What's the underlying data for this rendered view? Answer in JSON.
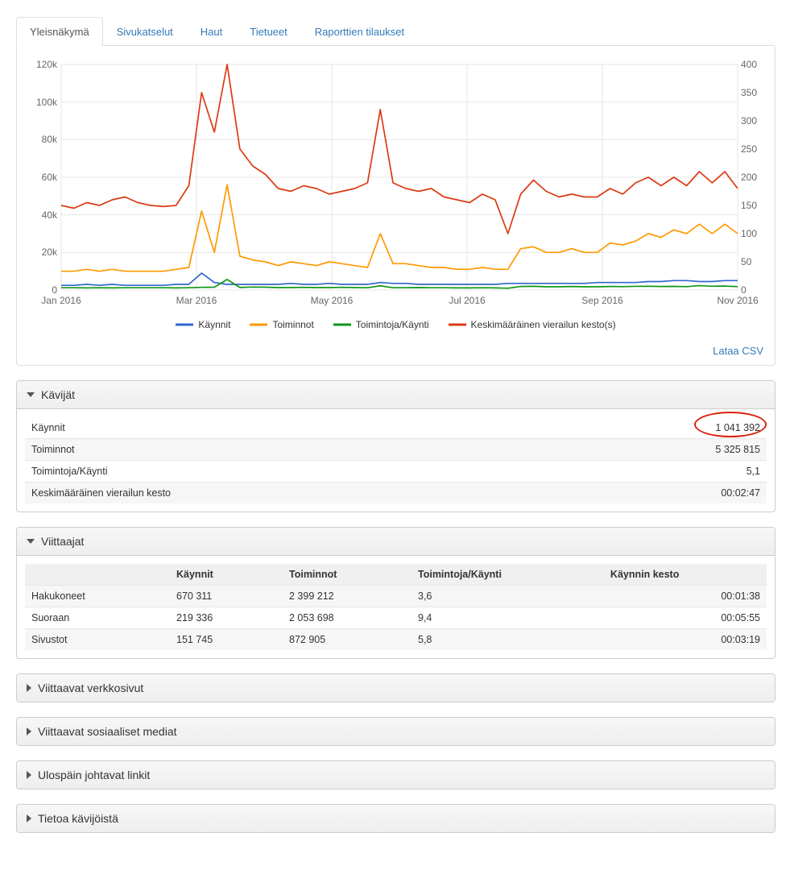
{
  "tabs": [
    "Yleisnäkymä",
    "Sivukatselut",
    "Haut",
    "Tietueet",
    "Raporttien tilaukset"
  ],
  "legend": {
    "visits": "Käynnit",
    "actions": "Toiminnot",
    "perVisit": "Toimintoja/Käynti",
    "avgDuration": "Keskimääräinen vierailun kesto(s)"
  },
  "download": "Lataa CSV",
  "panel_visitors": {
    "title": "Kävijät",
    "rows": [
      [
        "Käynnit",
        "1 041 392"
      ],
      [
        "Toiminnot",
        "5 325 815"
      ],
      [
        "Toimintoja/Käynti",
        "5,1"
      ],
      [
        "Keskimääräinen vierailun kesto",
        "00:02:47"
      ]
    ]
  },
  "panel_referrers": {
    "title": "Viittaajat",
    "headers": [
      "",
      "Käynnit",
      "Toiminnot",
      "Toimintoja/Käynti",
      "Käynnin kesto"
    ],
    "rows": [
      [
        "Hakukoneet",
        "670 311",
        "2 399 212",
        "3,6",
        "00:01:38"
      ],
      [
        "Suoraan",
        "219 336",
        "2 053 698",
        "9,4",
        "00:05:55"
      ],
      [
        "Sivustot",
        "151 745",
        "872 905",
        "5,8",
        "00:03:19"
      ]
    ]
  },
  "collapsed_panels": [
    "Viittaavat verkkosivut",
    "Viittaavat sosiaaliset mediat",
    "Ulospäin johtavat linkit",
    "Tietoa kävijöistä"
  ],
  "chart_data": {
    "type": "line",
    "x_ticks": [
      "Jan 2016",
      "Mar 2016",
      "May 2016",
      "Jul 2016",
      "Sep 2016",
      "Nov 2016"
    ],
    "y_left_ticks": [
      "0",
      "20k",
      "40k",
      "60k",
      "80k",
      "100k",
      "120k"
    ],
    "y_right_ticks": [
      "0",
      "50",
      "100",
      "150",
      "200",
      "250",
      "300",
      "350",
      "400"
    ],
    "y_left_range": [
      0,
      120000
    ],
    "y_right_range": [
      0,
      400
    ],
    "series": [
      {
        "name": "Käynnit",
        "color": "#3366cc",
        "axis": "left",
        "approx_values": [
          2500,
          2500,
          3000,
          2500,
          3000,
          2500,
          2500,
          2500,
          2500,
          3000,
          3000,
          9000,
          4000,
          3000,
          3000,
          3000,
          3000,
          3000,
          3500,
          3000,
          3000,
          3500,
          3000,
          3000,
          3000,
          4000,
          3500,
          3500,
          3000,
          3000,
          3000,
          3000,
          3000,
          3000,
          3000,
          3500,
          3500,
          3500,
          3500,
          3500,
          3500,
          3500,
          4000,
          4000,
          4000,
          4000,
          4500,
          4500,
          5000,
          5000,
          4500,
          4500,
          5000,
          5000
        ]
      },
      {
        "name": "Toiminnot",
        "color": "#ff9900",
        "axis": "left",
        "approx_values": [
          10000,
          10000,
          11000,
          10000,
          11000,
          10000,
          10000,
          10000,
          10000,
          11000,
          12000,
          42000,
          20000,
          56000,
          18000,
          16000,
          15000,
          13000,
          15000,
          14000,
          13000,
          15000,
          14000,
          13000,
          12000,
          30000,
          14000,
          14000,
          13000,
          12000,
          12000,
          11000,
          11000,
          12000,
          11000,
          11000,
          22000,
          23000,
          20000,
          20000,
          22000,
          20000,
          20000,
          25000,
          24000,
          26000,
          30000,
          28000,
          32000,
          30000,
          35000,
          30000,
          35000,
          30000
        ]
      },
      {
        "name": "Toimintoja/Käynti",
        "color": "#109618",
        "axis": "right",
        "approx_values": [
          4,
          4,
          3.7,
          4,
          3.7,
          4,
          4,
          4,
          4,
          3.7,
          4,
          4.7,
          5,
          18.7,
          4.5,
          5.3,
          5,
          4.3,
          4.3,
          4.7,
          4.3,
          4.3,
          4.7,
          4.3,
          4,
          7.5,
          4,
          4,
          4.3,
          4,
          4,
          3.7,
          3.7,
          4,
          3.7,
          3.1,
          6.3,
          6.6,
          5.7,
          5.7,
          6.3,
          5.7,
          5.7,
          6.3,
          6,
          6.5,
          6.7,
          6.2,
          6.4,
          6,
          7.8,
          6.7,
          7,
          6
        ]
      },
      {
        "name": "Keskimääräinen vierailun kesto(s)",
        "color": "#dc3912",
        "axis": "right",
        "approx_values": [
          150,
          145,
          155,
          150,
          160,
          165,
          155,
          150,
          148,
          150,
          185,
          350,
          280,
          400,
          250,
          220,
          205,
          180,
          175,
          185,
          180,
          170,
          175,
          180,
          190,
          320,
          190,
          180,
          175,
          180,
          165,
          160,
          155,
          170,
          160,
          100,
          170,
          195,
          175,
          165,
          170,
          165,
          165,
          180,
          170,
          190,
          200,
          185,
          200,
          185,
          210,
          190,
          210,
          180
        ]
      }
    ]
  }
}
